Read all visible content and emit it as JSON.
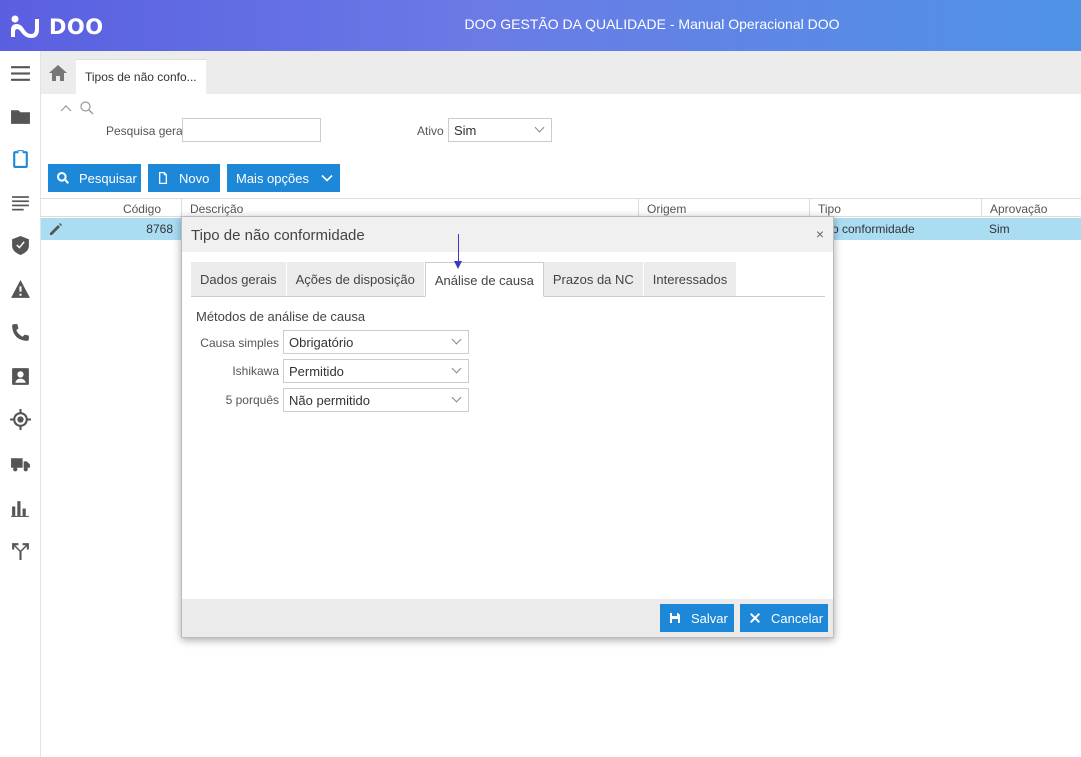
{
  "header": {
    "logo_text": "DOO",
    "title": "DOO GESTÃO DA QUALIDADE - Manual Operacional DOO",
    "color": "#5a5fe0"
  },
  "sidebar": {
    "items": [
      {
        "icon": "hamburger-menu-icon"
      },
      {
        "icon": "folder-icon"
      },
      {
        "icon": "clipboard-icon",
        "active": true
      },
      {
        "icon": "list-lines-icon"
      },
      {
        "icon": "shield-check-icon"
      },
      {
        "icon": "warning-icon"
      },
      {
        "icon": "phone-icon"
      },
      {
        "icon": "contact-card-icon"
      },
      {
        "icon": "target-icon"
      },
      {
        "icon": "truck-icon"
      },
      {
        "icon": "bar-chart-icon"
      },
      {
        "icon": "branch-icon"
      }
    ]
  },
  "tabbar": {
    "page_tab": "Tipos de não confo..."
  },
  "filters": {
    "search_label": "Pesquisa geral",
    "search_value": "",
    "active_label": "Ativo",
    "active_value": "Sim"
  },
  "toolbar": {
    "search_label": "Pesquisar",
    "new_label": "Novo",
    "more_label": "Mais opções",
    "accent": "#1e88d8"
  },
  "grid": {
    "columns": [
      "Código",
      "Descrição",
      "Origem",
      "Tipo",
      "Aprovação"
    ],
    "rows": [
      {
        "codigo": "8768",
        "descricao": "",
        "origem": "",
        "tipo": "o conformidade",
        "aprovacao": "Sim"
      }
    ]
  },
  "modal": {
    "title": "Tipo de não conformidade",
    "close": "×",
    "tabs": [
      "Dados gerais",
      "Ações de disposição",
      "Análise de causa",
      "Prazos da NC",
      "Interessados"
    ],
    "active_tab": "Análise de causa",
    "section_title": "Métodos de análise de causa",
    "fields": [
      {
        "label": "Causa simples",
        "value": "Obrigatório"
      },
      {
        "label": "Ishikawa",
        "value": "Permitido"
      },
      {
        "label": "5 porquês",
        "value": "Não permitido"
      }
    ],
    "save_label": "Salvar",
    "cancel_label": "Cancelar"
  }
}
